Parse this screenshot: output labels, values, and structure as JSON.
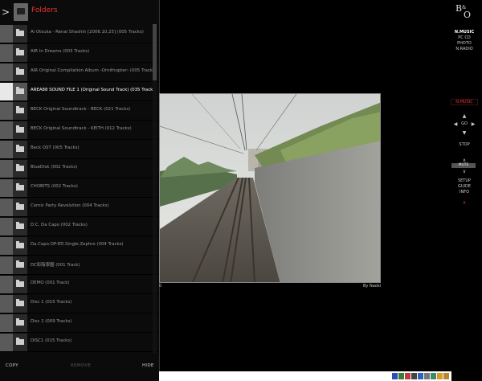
{
  "panel": {
    "title": "Folders",
    "back_glyph": ">",
    "folders": [
      {
        "label": "Ai Otsuka - Renai Shashin [2006.10.25] (005 Tracks)"
      },
      {
        "label": "AIR In Dreams (003 Tracks)"
      },
      {
        "label": "AIR Original Compilation Album ‹Ornithopter› (005 Tracks)"
      },
      {
        "label": "AREA88 SOUND FILE 1 (Original Sound Track) (035 Tracks)"
      },
      {
        "label": "BECK Original Soundtrack - BECK (021 Tracks)"
      },
      {
        "label": "BECK Original Soundtrack - KEITH (012 Tracks)"
      },
      {
        "label": "Beck OST (005 Tracks)"
      },
      {
        "label": "BlueDisk (002 Tracks)"
      },
      {
        "label": "CHOBITS (002 Tracks)"
      },
      {
        "label": "Comic Party Revolution (004 Tracks)"
      },
      {
        "label": "D.C. Da Capo (002 Tracks)"
      },
      {
        "label": "Da.Capo.OP-ED.Single.Zephro (004 Tracks)"
      },
      {
        "label": "DC彩陰學園 (001 Track)"
      },
      {
        "label": "DEMO (001 Track)"
      },
      {
        "label": "Disc 1 (015 Tracks)"
      },
      {
        "label": "Disc 2 (009 Tracks)"
      },
      {
        "label": "DISC1 (015 Tracks)"
      }
    ],
    "selected_index": 3,
    "footer": {
      "copy": "COPY",
      "remove": "REMOVE",
      "hide": "HIDE"
    }
  },
  "photo": {
    "index_label": "0",
    "credit": "By Naoki"
  },
  "brand": {
    "b": "B",
    "amp": "&",
    "o": "O"
  },
  "sources": {
    "nmusic": "N.MUSIC",
    "pccd": "PC CD",
    "photo": "PHOTO",
    "nradio": "N.RADIO"
  },
  "active_source": "N.MUSIC",
  "controls": {
    "up": "▲",
    "prev": "◀",
    "go": "GO",
    "next": "▶",
    "down": "▼",
    "stop": "STOP",
    "vol_up": "∧",
    "mute": "MUTE",
    "vol_down": "∨",
    "setup": "SETUP",
    "guide": "GUIDE",
    "info": "INFO",
    "close": "X"
  },
  "colors": {
    "accent": "#e33333",
    "panel": "#0b0b0b",
    "selected_row": "#e8e8e8"
  },
  "tray_icons": [
    "double-arrow-icon",
    "sync-icon",
    "shield-icon",
    "grid-icon",
    "mail-icon",
    "camera-icon",
    "monitor-icon",
    "chat-icon",
    "folder-icon"
  ]
}
